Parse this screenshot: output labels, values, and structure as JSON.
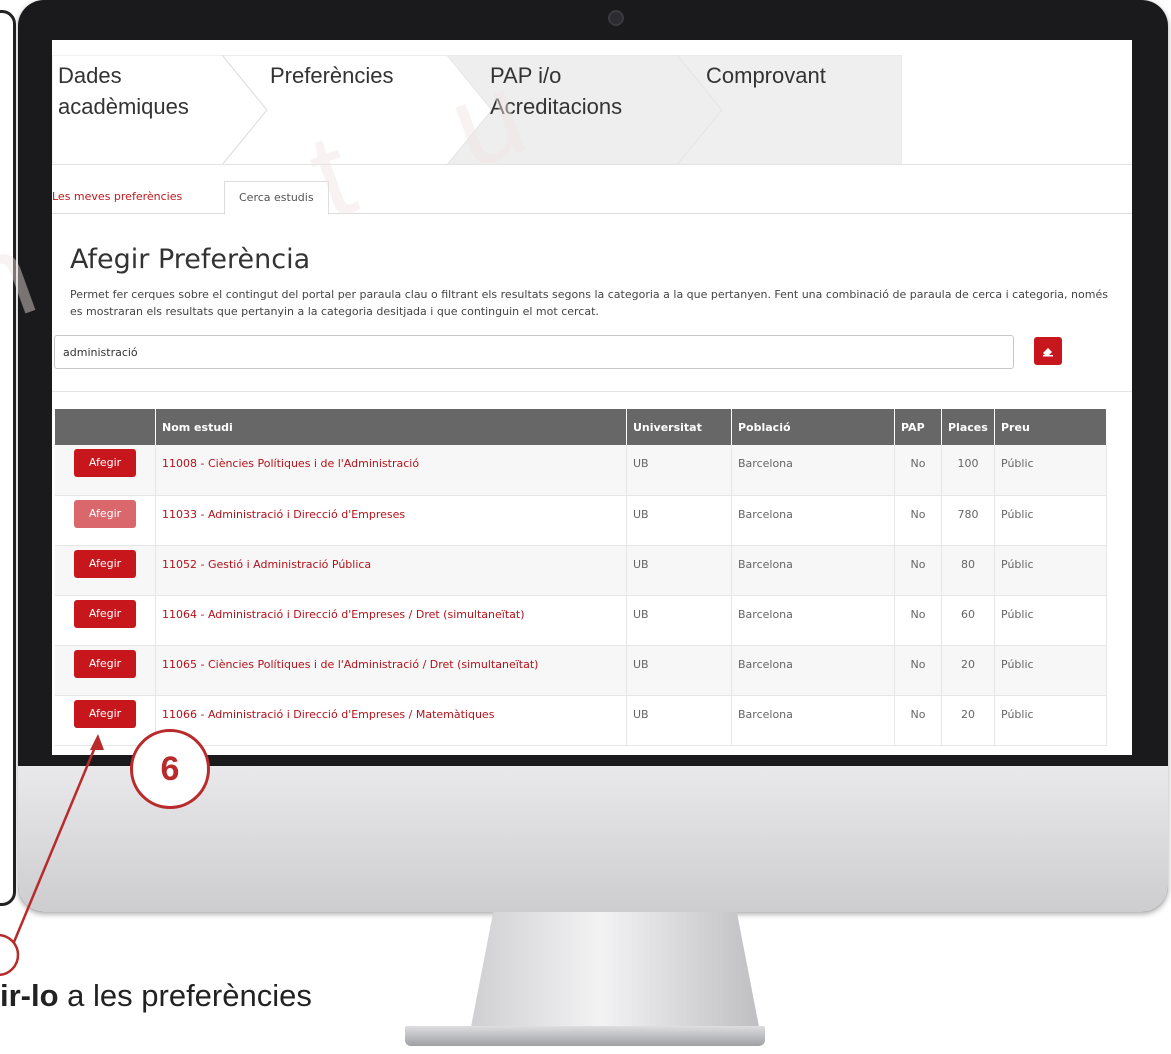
{
  "steps": [
    {
      "line1": "Dades",
      "line2": "acadèmiques"
    },
    {
      "line1": "Preferències",
      "line2": ""
    },
    {
      "line1": "PAP i/o",
      "line2": "Acreditacions"
    },
    {
      "line1": "Comprovant",
      "line2": ""
    }
  ],
  "subtabs": {
    "my_preferences": "Les meves preferències",
    "search_studies": "Cerca estudis"
  },
  "page": {
    "title": "Afegir Preferència",
    "description": "Permet fer cerques sobre el contingut del portal per paraula clau o filtrant els resultats segons la categoria a la que pertanyen. Fent una combinació de paraula de cerca i categoria, només es mostraran els resultats que pertanyin a la categoria desitjada i que continguin el mot cercat."
  },
  "search": {
    "value": "administració",
    "button_icon": "search-icon"
  },
  "table": {
    "headers": [
      "",
      "Nom estudi",
      "Universitat",
      "Població",
      "PAP",
      "Places",
      "Preu"
    ],
    "add_label": "Afegir",
    "rows": [
      {
        "name": "11008 - Ciències Polítiques i de l'Administració",
        "university": "UB",
        "city": "Barcelona",
        "pap": "No",
        "places": "100",
        "price": "Públic"
      },
      {
        "name": "11033 - Administració i Direcció d'Empreses",
        "university": "UB",
        "city": "Barcelona",
        "pap": "No",
        "places": "780",
        "price": "Públic"
      },
      {
        "name": "11052 - Gestió i Administració Pública",
        "university": "UB",
        "city": "Barcelona",
        "pap": "No",
        "places": "80",
        "price": "Públic"
      },
      {
        "name": "11064 - Administració i Direcció d'Empreses / Dret (simultaneïtat)",
        "university": "UB",
        "city": "Barcelona",
        "pap": "No",
        "places": "60",
        "price": "Públic"
      },
      {
        "name": "11065 - Ciències Polítiques i de l'Administració / Dret (simultaneïtat)",
        "university": "UB",
        "city": "Barcelona",
        "pap": "No",
        "places": "20",
        "price": "Públic"
      },
      {
        "name": "11066 - Administració i Direcció d'Empreses / Matemàtiques",
        "university": "UB",
        "city": "Barcelona",
        "pap": "No",
        "places": "20",
        "price": "Públic"
      }
    ]
  },
  "annotation": {
    "number": "6",
    "caption_bold": "ir-lo",
    "caption_rest": " a les preferències"
  },
  "colors": {
    "accent": "#c8161d",
    "link": "#b3121a",
    "header_bg": "#676767",
    "annotation": "#b92a2a"
  }
}
